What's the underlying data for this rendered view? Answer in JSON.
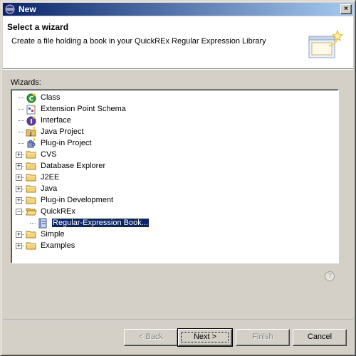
{
  "window": {
    "title": "New",
    "close_glyph": "×"
  },
  "header": {
    "title": "Select a wizard",
    "description": "Create a file holding a book in your QuickREx Regular Expression Library"
  },
  "wizards_label": "Wizards:",
  "tree": [
    {
      "label": "Class",
      "icon": "class-icon",
      "depth": 1
    },
    {
      "label": "Extension Point Schema",
      "icon": "schema-icon",
      "depth": 1
    },
    {
      "label": "Interface",
      "icon": "interface-icon",
      "depth": 1
    },
    {
      "label": "Java Project",
      "icon": "java-project-icon",
      "depth": 1
    },
    {
      "label": "Plug-in Project",
      "icon": "plugin-project-icon",
      "depth": 1
    },
    {
      "label": "CVS",
      "icon": "folder-icon",
      "depth": 1,
      "expander": "+"
    },
    {
      "label": "Database Explorer",
      "icon": "folder-icon",
      "depth": 1,
      "expander": "+"
    },
    {
      "label": "J2EE",
      "icon": "folder-icon",
      "depth": 1,
      "expander": "+"
    },
    {
      "label": "Java",
      "icon": "folder-icon",
      "depth": 1,
      "expander": "+"
    },
    {
      "label": "Plug-in Development",
      "icon": "folder-icon",
      "depth": 1,
      "expander": "+"
    },
    {
      "label": "QuickREx",
      "icon": "folder-open-icon",
      "depth": 1,
      "expander": "-"
    },
    {
      "label": "Regular-Expression Book...",
      "icon": "book-icon",
      "depth": 2,
      "selected": true
    },
    {
      "label": "Simple",
      "icon": "folder-icon",
      "depth": 1,
      "expander": "+"
    },
    {
      "label": "Examples",
      "icon": "folder-icon",
      "depth": 1,
      "expander": "+"
    }
  ],
  "help_glyph": "?",
  "buttons": {
    "back": "< Back",
    "next": "Next >",
    "finish": "Finish",
    "cancel": "Cancel"
  }
}
